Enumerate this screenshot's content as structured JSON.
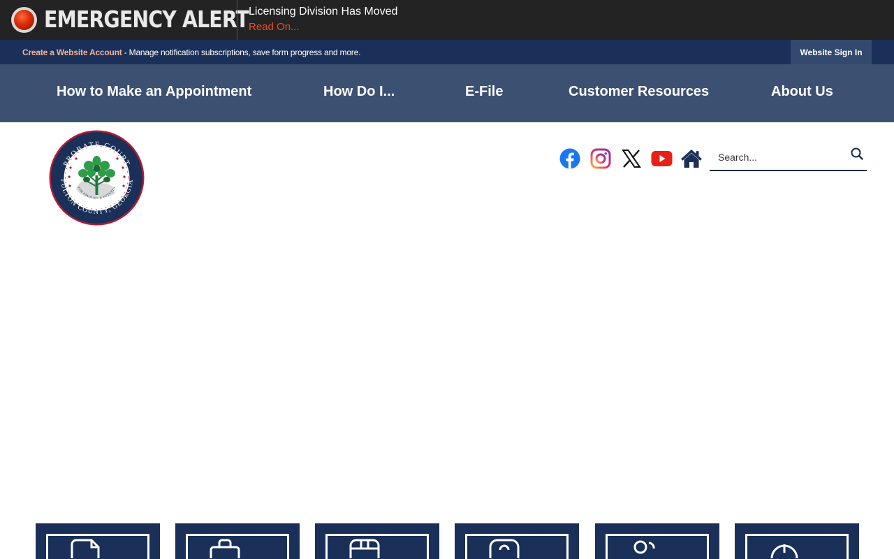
{
  "alert": {
    "title": "EMERGENCY ALERT",
    "headline": "Licensing Division Has Moved",
    "link_label": "Read On...",
    "icon": "alert-beacon-icon"
  },
  "account": {
    "create_link": "Create a Website Account",
    "description": " - Manage notification subscriptions, save form progress and more.",
    "signin_label": "Website Sign In"
  },
  "nav": {
    "items": [
      {
        "label": "How to Make an Appointment"
      },
      {
        "label": "How Do I..."
      },
      {
        "label": "E-File"
      },
      {
        "label": "Customer Resources"
      },
      {
        "label": "About Us"
      }
    ]
  },
  "logo": {
    "top_text": "PROBATE COURT",
    "bottom_text": "FULTON COUNTY, GEORGIA",
    "motto": "FOR FAMILIES & FUTURES"
  },
  "social": {
    "icons": [
      "facebook-icon",
      "instagram-icon",
      "x-icon",
      "youtube-icon",
      "home-icon"
    ]
  },
  "search": {
    "placeholder": "Search..."
  },
  "tiles": {
    "icons": [
      "document-icon",
      "briefcase-icon",
      "calendar-icon",
      "contact-icon",
      "people-icon",
      "clock-icon"
    ]
  },
  "colors": {
    "alert_bar": "#232323",
    "alert_link": "#e94d2c",
    "account_bar": "#1a3058",
    "nav_bar": "#3c5072",
    "tile": "#1a3058"
  }
}
